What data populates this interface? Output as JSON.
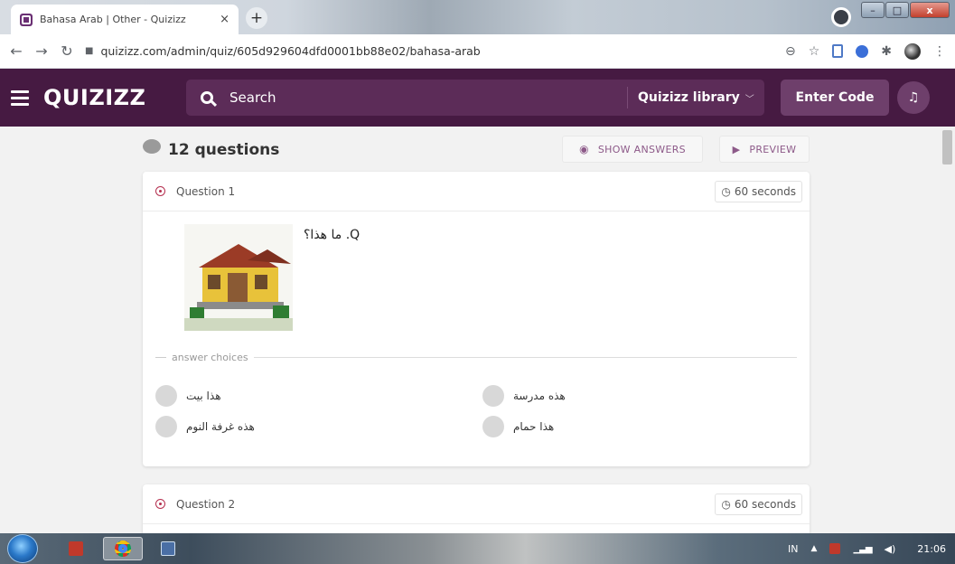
{
  "browser": {
    "tab_title": "Bahasa Arab | Other - Quizizz",
    "tab_close": "×",
    "new_tab": "+",
    "url": "quizizz.com/admin/quiz/605d929604dfd0001bb88e02/bahasa-arab"
  },
  "header": {
    "logo": "QUIZIZZ",
    "search_placeholder": "Search",
    "library_label": "Quizizz library",
    "enter_code_label": "Enter Code"
  },
  "quiz": {
    "question_count": "12 questions",
    "show_answers_label": "SHOW ANSWERS",
    "preview_label": "PREVIEW",
    "questions": [
      {
        "label": "Question 1",
        "time": "60 seconds",
        "text": "ما هذا؟ .Q",
        "choices_heading": "answer choices",
        "choices": [
          "هذا بيت",
          "هذه مدرسة",
          "هذه غرفة النوم",
          "هذا حمام"
        ]
      },
      {
        "label": "Question 2",
        "time": "60 seconds"
      }
    ]
  },
  "taskbar": {
    "lang": "IN",
    "time": "21:06"
  },
  "colors": {
    "header_bg": "#461a42",
    "accent_purple": "#8d5a89",
    "question_icon": "#b52f4f"
  }
}
